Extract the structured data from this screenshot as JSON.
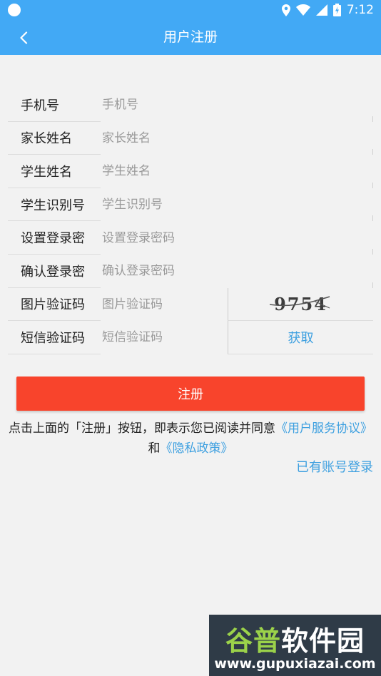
{
  "status_bar": {
    "time": "7:12"
  },
  "app_bar": {
    "title": "用户注册",
    "back_icon": "chevron-left-icon"
  },
  "form": {
    "rows": [
      {
        "label": "手机号",
        "placeholder": "手机号"
      },
      {
        "label": "家长姓名",
        "placeholder": "家长姓名"
      },
      {
        "label": "学生姓名",
        "placeholder": "学生姓名"
      },
      {
        "label": "学生识别号",
        "placeholder": "学生识别号"
      },
      {
        "label": "设置登录密",
        "placeholder": "设置登录密码"
      },
      {
        "label": "确认登录密",
        "placeholder": "确认登录密码"
      },
      {
        "label": "图片验证码",
        "placeholder": "图片验证码"
      },
      {
        "label": "短信验证码",
        "placeholder": "短信验证码"
      }
    ],
    "captcha_text": "9754",
    "get_code_label": "获取"
  },
  "submit_label": "注册",
  "agreement": {
    "prefix": "点击上面的「注册」按钮，即表示您已阅读并同意",
    "terms_link": "《用户服务协议》",
    "and": "和",
    "privacy_link": "《隐私政策》"
  },
  "login_link": "已有账号登录",
  "watermark": {
    "brand_a": "谷普",
    "brand_b": "软件园",
    "url": "www.gupuxiazai.com"
  },
  "colors": {
    "primary": "#42a9f5",
    "accent_button": "#f8442c",
    "link": "#3ea0e0",
    "background": "#f2f2f2"
  }
}
